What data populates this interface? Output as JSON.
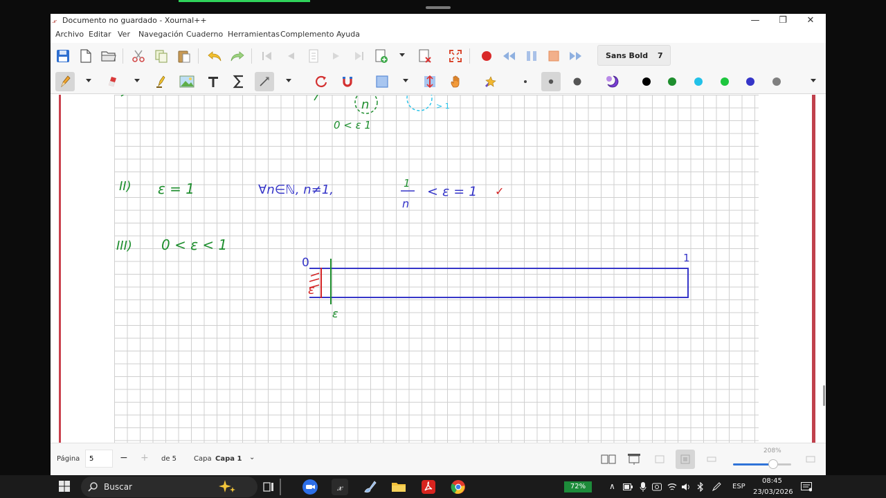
{
  "window": {
    "title": "Documento no guardado - Xournal++",
    "app_icon": "𝓍",
    "controls": {
      "minimize": "—",
      "maximize": "❐",
      "close": "✕"
    }
  },
  "menu": [
    "Archivo",
    "Editar",
    "Ver",
    "Navegación",
    "Cuaderno",
    "Herramientas",
    "Complemento",
    "Ayuda"
  ],
  "toolbar1": {
    "icons": [
      "save-icon",
      "new-document-icon",
      "open-folder-icon",
      "cut-icon",
      "copy-icon",
      "paste-icon",
      "undo-icon",
      "redo-icon",
      "first-page-icon",
      "previous-page-icon",
      "goto-page-icon",
      "next-page-icon",
      "last-page-icon",
      "add-page-icon",
      "delete-page-icon",
      "fullscreen-icon",
      "record-icon",
      "rewind-icon",
      "pause-icon",
      "stop-icon",
      "fast-forward-icon"
    ],
    "font": {
      "name": "Sans Bold",
      "size": "7"
    }
  },
  "toolbar2": {
    "icons": [
      "pen-icon",
      "eraser-icon",
      "highlighter-icon",
      "image-icon",
      "text-icon",
      "math-icon",
      "select-tool-icon",
      "rotation-snap-icon",
      "grid-snap-icon",
      "select-rectangle-icon",
      "vertical-space-icon",
      "hand-icon",
      "tool-settings-icon",
      "thickness-fine-icon",
      "thickness-medium-icon",
      "thickness-thick-icon",
      "fill-icon"
    ],
    "color_palette": [
      "#000000",
      "#1e8e2e",
      "#22c1e8",
      "#1ec63e",
      "#3535c8",
      "#808080"
    ]
  },
  "note_text": {
    "case2_label": "II)",
    "case2_eps": "ε = 1",
    "case2_condition": "∀n∈ℕ, n≠1,",
    "case2_ineq": "< ε = 1",
    "frac_num": "1",
    "frac_den": "n",
    "checkmark": "✓",
    "case3_label": "III)",
    "case3_cond": "0 < ε < 1",
    "top_frag1": "n",
    "top_frag2": "> 1",
    "top_ineq": "0 <   ε 1",
    "diagram_zero": "0",
    "diagram_one": "1",
    "diagram_eps_bottom": "ε",
    "diagram_eps_left": "ε"
  },
  "status": {
    "page_label": "Página",
    "page_value": "5",
    "page_minus": "−",
    "page_plus": "+",
    "page_total": "de 5",
    "layer_label": "Capa",
    "layer_value": "Capa 1",
    "layer_arrow": "⌄",
    "zoom_label": "208%",
    "zoom_fraction": 0.69
  },
  "taskbar": {
    "search_placeholder": "Buscar",
    "battery": "72%",
    "language": "ESP",
    "time": "08:45",
    "date": "23/03/2026",
    "tray_up_arrow": "∧",
    "xournal_glyph": "𝓍"
  }
}
